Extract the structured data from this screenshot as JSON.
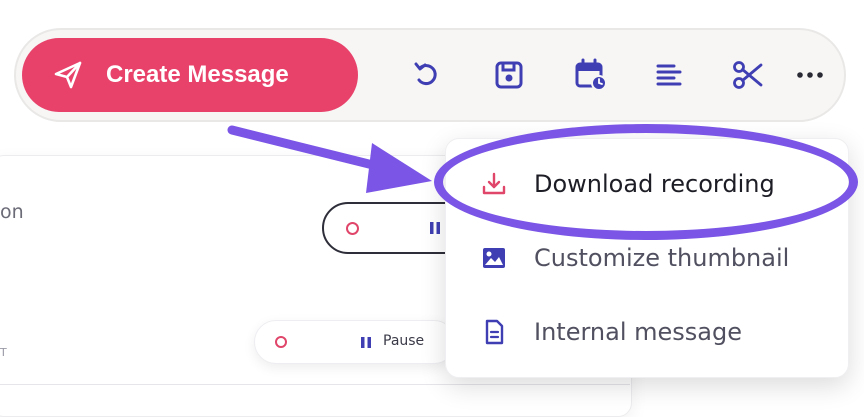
{
  "toolbar": {
    "create_label": "Create Message",
    "icons": [
      "undo-icon",
      "save-icon",
      "schedule-calendar-icon",
      "align-left-icon",
      "scissors-icon",
      "more-horizontal-icon"
    ]
  },
  "menu": {
    "items": [
      {
        "label": "Download recording",
        "icon": "download-icon"
      },
      {
        "label": "Customize thumbnail",
        "icon": "image-icon"
      },
      {
        "label": "Internal message",
        "icon": "document-icon"
      }
    ]
  },
  "background": {
    "partial_text": "on",
    "letter": "T",
    "pause_label": "Pause"
  },
  "colors": {
    "brand_pink": "#e8426b",
    "icon_indigo": "#3f3fb3",
    "annotation_purple": "#7a55e6",
    "download_red": "#e0456a"
  }
}
